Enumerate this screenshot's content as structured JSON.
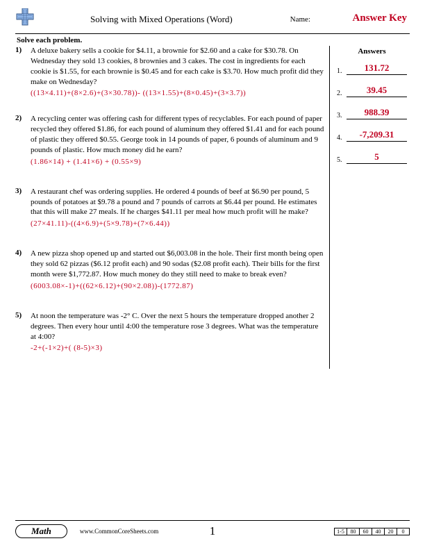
{
  "header": {
    "title": "Solving with Mixed Operations (Word)",
    "name_label": "Name:",
    "answer_key": "Answer Key"
  },
  "instruction": "Solve each problem.",
  "answers_title": "Answers",
  "problems": [
    {
      "num": "1)",
      "text": "A deluxe bakery sells a cookie for $4.11, a brownie for $2.60 and a cake for $30.78. On Wednesday they sold 13 cookies, 8 brownies and 3 cakes. The cost in ingredients for each cookie is $1.55, for each brownie is $0.45 and for each cake is $3.70. How much profit did they make on Wednesday?",
      "solution": "((13×4.11)+(8×2.6)+(3×30.78))- ((13×1.55)+(8×0.45)+(3×3.7))"
    },
    {
      "num": "2)",
      "text": "A recycling center was offering cash for different types of recyclables. For each pound of paper recycled they offered $1.86, for each pound of aluminum they offered $1.41 and for each pound of plastic they offered $0.55. George took in 14 pounds of paper, 6 pounds of aluminum and 9 pounds of plastic. How much money did he earn?",
      "solution": "(1.86×14) + (1.41×6) + (0.55×9)"
    },
    {
      "num": "3)",
      "text": "A restaurant chef was ordering supplies. He ordered 4 pounds of beef at $6.90 per pound, 5 pounds of potatoes at $9.78 a pound and 7 pounds of carrots at $6.44 per pound. He estimates that this will make 27 meals. If he charges $41.11 per meal how much profit will he make?",
      "solution": "(27×41.11)-((4×6.9)+(5×9.78)+(7×6.44))"
    },
    {
      "num": "4)",
      "text": "A new pizza shop opened up and started out $6,003.08 in the hole. Their first month being open they sold 62 pizzas ($6.12 profit each) and 90 sodas ($2.08 profit each). Their bills for the first month were $1,772.87. How much money do they still need to make to break even?",
      "solution": "(6003.08×-1)+((62×6.12)+(90×2.08))-(1772.87)"
    },
    {
      "num": "5)",
      "text": "At noon the temperature was -2° C. Over the next 5 hours the temperature dropped another 2 degrees. Then every hour until 4:00 the temperature rose 3 degrees. What was the temperature at 4:00?",
      "solution": "-2+(-1×2)+( (8-5)×3)"
    }
  ],
  "answers": [
    {
      "num": "1.",
      "value": "131.72"
    },
    {
      "num": "2.",
      "value": "39.45"
    },
    {
      "num": "3.",
      "value": "988.39"
    },
    {
      "num": "4.",
      "value": "-7,209.31"
    },
    {
      "num": "5.",
      "value": "5"
    }
  ],
  "footer": {
    "subject": "Math",
    "site": "www.CommonCoreSheets.com",
    "page": "1",
    "score_label": "1-5",
    "score_cells": [
      "80",
      "60",
      "40",
      "20",
      "0"
    ]
  }
}
